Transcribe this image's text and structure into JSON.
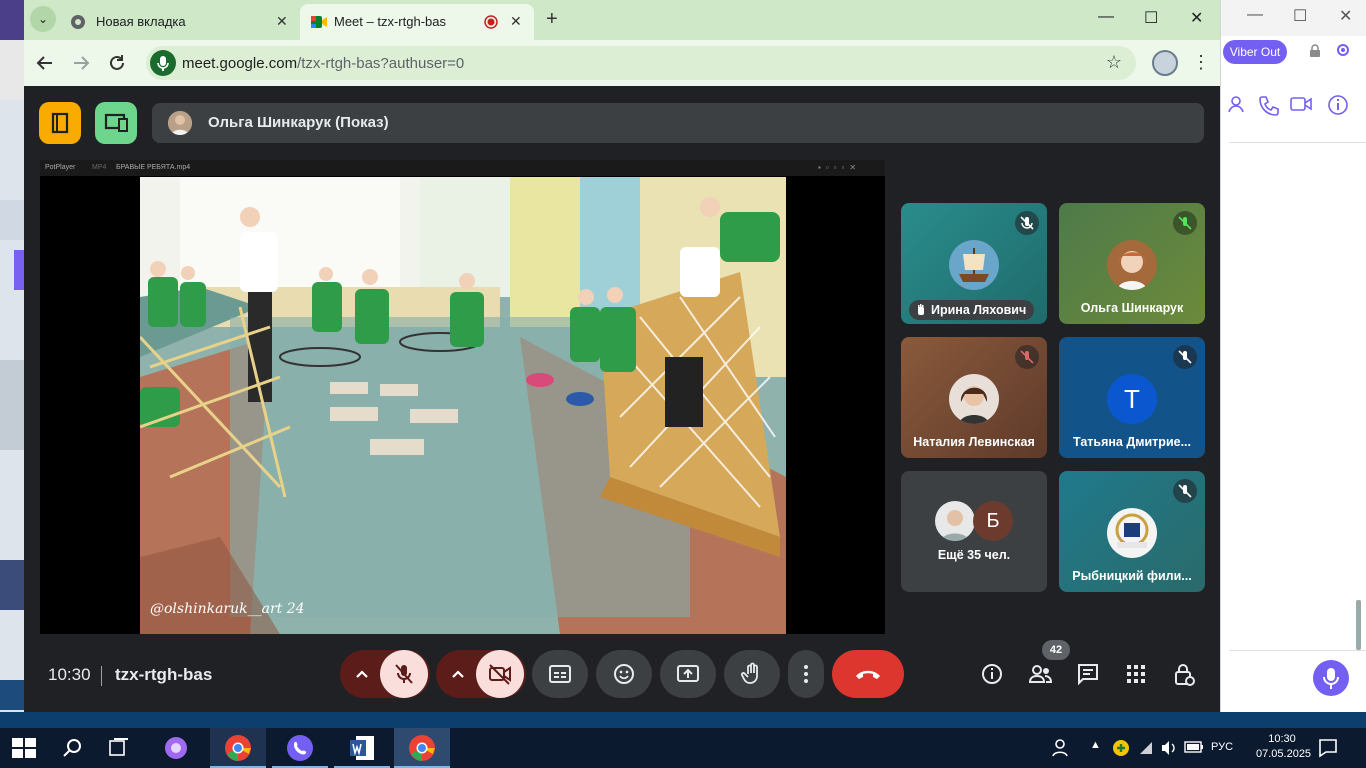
{
  "browser": {
    "tabs": [
      {
        "title": "Новая вкладка"
      },
      {
        "title": "Meet – tzx-rtgh-bas"
      }
    ],
    "url_host": "meet.google.com",
    "url_path": "/tzx-rtgh-bas?authuser=0",
    "accent": "#cfe8c8"
  },
  "viber": {
    "viber_out_label": "Viber Out",
    "brand_color": "#7360f2"
  },
  "meet": {
    "presenter_label": "Ольга Шинкарук (Показ)",
    "player": {
      "app": "PotPlayer",
      "format": "MP4",
      "file": "БРАВЫЕ РЕБЯТА.mp4",
      "watermark": "@olshinkaruk__art 24"
    },
    "participants": [
      {
        "name": "Ирина Ляхович",
        "muted": true,
        "hand_raised": true,
        "icon": "hand-icon"
      },
      {
        "name": "Ольга Шинкарук",
        "muted": true
      },
      {
        "name": "Наталия Левинская",
        "muted": true
      },
      {
        "name": "Татьяна Дмитрие...",
        "muted": true,
        "initial": "Т"
      },
      {
        "name": "Ещё 35 чел.",
        "initial": "Б"
      },
      {
        "name": "Рыбницкий фили...",
        "muted": true
      }
    ],
    "bottom": {
      "time": "10:30",
      "meeting_code": "tzx-rtgh-bas",
      "people_count": "42"
    }
  },
  "taskbar": {
    "language": "РУС",
    "time": "10:30",
    "date": "07.05.2025"
  }
}
